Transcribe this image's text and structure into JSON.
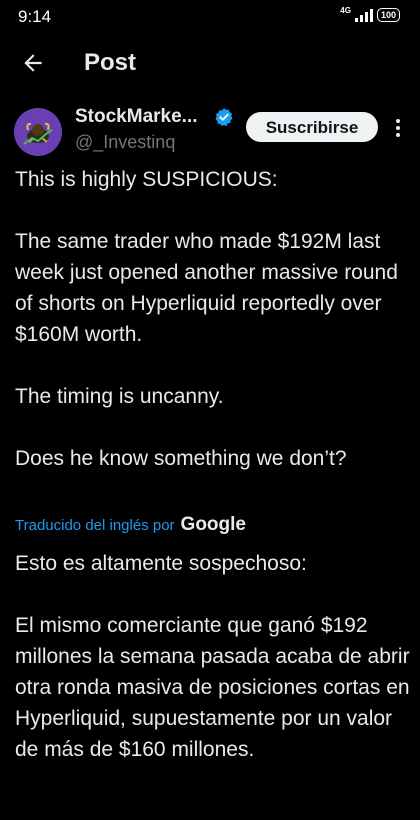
{
  "status_bar": {
    "time": "9:14",
    "network": "4G",
    "battery": "100"
  },
  "header": {
    "title": "Post"
  },
  "author": {
    "name": "StockMarke...",
    "handle": "@_Investinq",
    "subscribe_label": "Suscribirse"
  },
  "post": {
    "paragraphs": [
      "This is highly SUSPICIOUS:",
      "The same trader who made $192M last week just opened another massive round of shorts on Hyperliquid reportedly over $160M worth.",
      "The timing is uncanny.",
      "Does he know something we don’t?"
    ]
  },
  "translation": {
    "label": "Traducido del inglés por",
    "provider": "Google",
    "paragraphs": [
      "Esto es altamente sospechoso:",
      "El mismo comerciante que ganó $192 millones la semana pasada acaba de abrir otra ronda masiva de posiciones cortas en Hyperliquid, supuestamente por un valor de más de $160 millones."
    ]
  },
  "colors": {
    "background": "#000000",
    "text": "#e7e9ea",
    "secondary": "#71767b",
    "link": "#1d9bf0",
    "verified": "#1d9bf0",
    "button_bg": "#eff3f4"
  }
}
